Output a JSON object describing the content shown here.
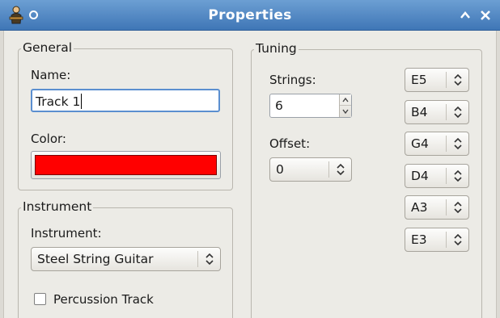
{
  "window": {
    "title": "Properties"
  },
  "general": {
    "legend": "General",
    "name_label": "Name:",
    "name_value": "Track 1",
    "color_label": "Color:",
    "color_value": "#ff0000"
  },
  "instrument": {
    "legend": "Instrument",
    "label": "Instrument:",
    "selected": "Steel String Guitar",
    "percussion_label": "Percussion Track",
    "percussion_checked": false
  },
  "tuning": {
    "legend": "Tuning",
    "strings_label": "Strings:",
    "strings_value": "6",
    "offset_label": "Offset:",
    "offset_value": "0",
    "notes": [
      "E5",
      "B4",
      "G4",
      "D4",
      "A3",
      "E3"
    ]
  },
  "icons": [
    "app-icon",
    "window-menu-icon",
    "maximize-icon",
    "close-icon",
    "chevron-updown-icon",
    "spin-up-icon",
    "spin-down-icon"
  ]
}
